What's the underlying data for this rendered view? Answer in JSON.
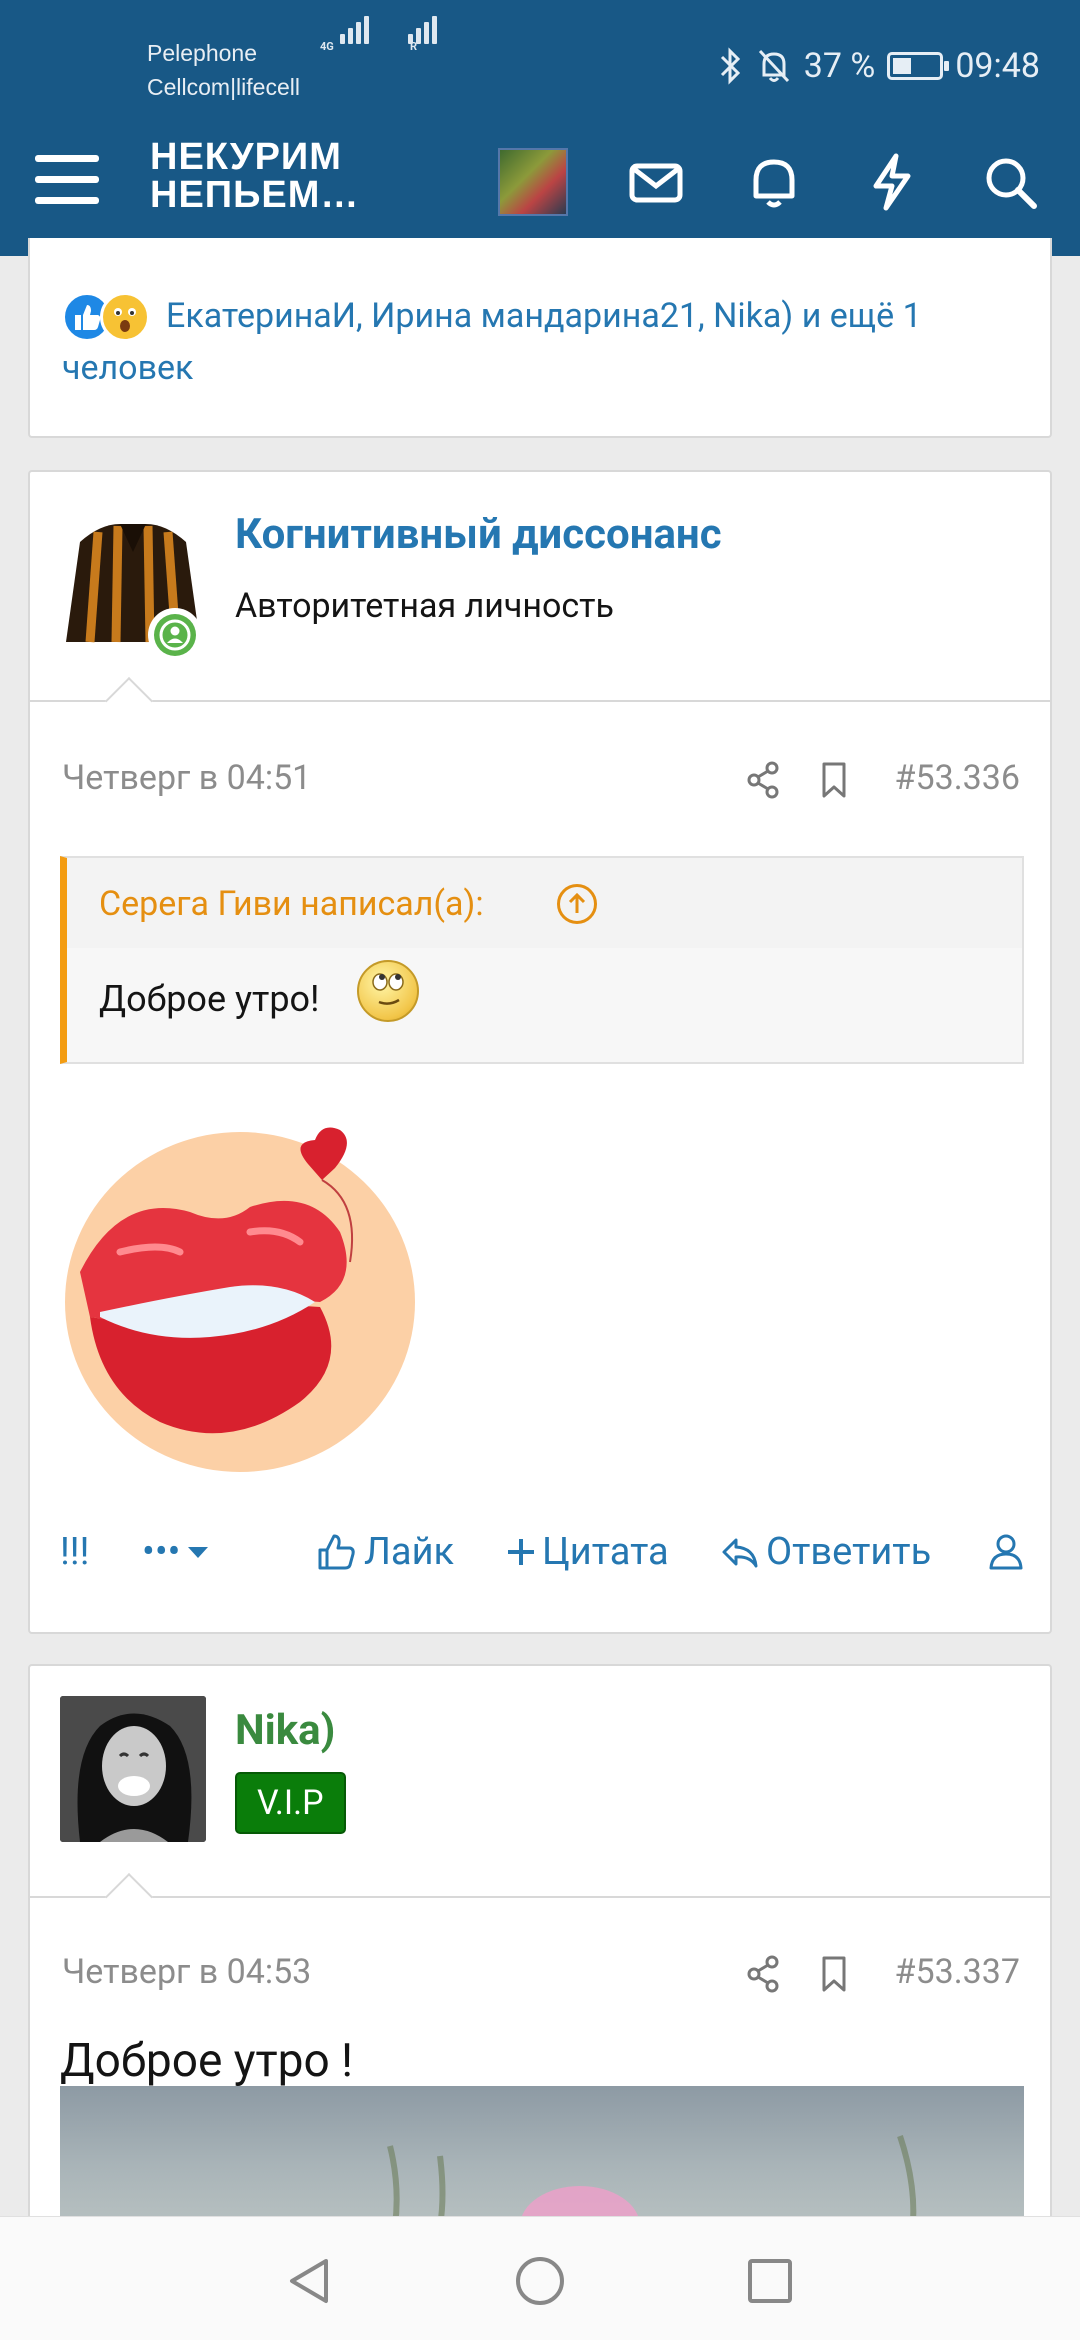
{
  "status_bar": {
    "carrier_1": "Pelephone",
    "carrier_2": "Cellcom|lifecell",
    "net_label": "4G",
    "roaming_label": "R",
    "battery": "37 %",
    "time": "09:48"
  },
  "header": {
    "logo_line1": "НЕКУРИМ",
    "logo_line2": "НЕПЬЕМ…"
  },
  "reactions": {
    "text": "ЕкатеринаИ, Ирина мандарина21, Nika) и ещё 1 человек"
  },
  "post1": {
    "username": "Когнитивный диссонанс",
    "user_title": "Авторитетная личность",
    "date": "Четверг в 04:51",
    "post_number": "#53.336",
    "quote_author": "Серега Гиви написал(а):",
    "quote_text": "Доброе утро!",
    "actions": {
      "exclaim": "!!!",
      "more": "•••",
      "like": "Лайк",
      "quote": "Цитата",
      "reply": "Ответить"
    }
  },
  "post2": {
    "username": "Nika)",
    "badge": "V.I.P",
    "date": "Четверг в 04:53",
    "post_number": "#53.337",
    "text": "Доброе утро !"
  },
  "colors": {
    "header_bg": "#185886",
    "link": "#2577b1",
    "quote_accent": "#f39c12",
    "vip_bg": "#0a7d0a",
    "nika_name": "#3a8a3f"
  }
}
